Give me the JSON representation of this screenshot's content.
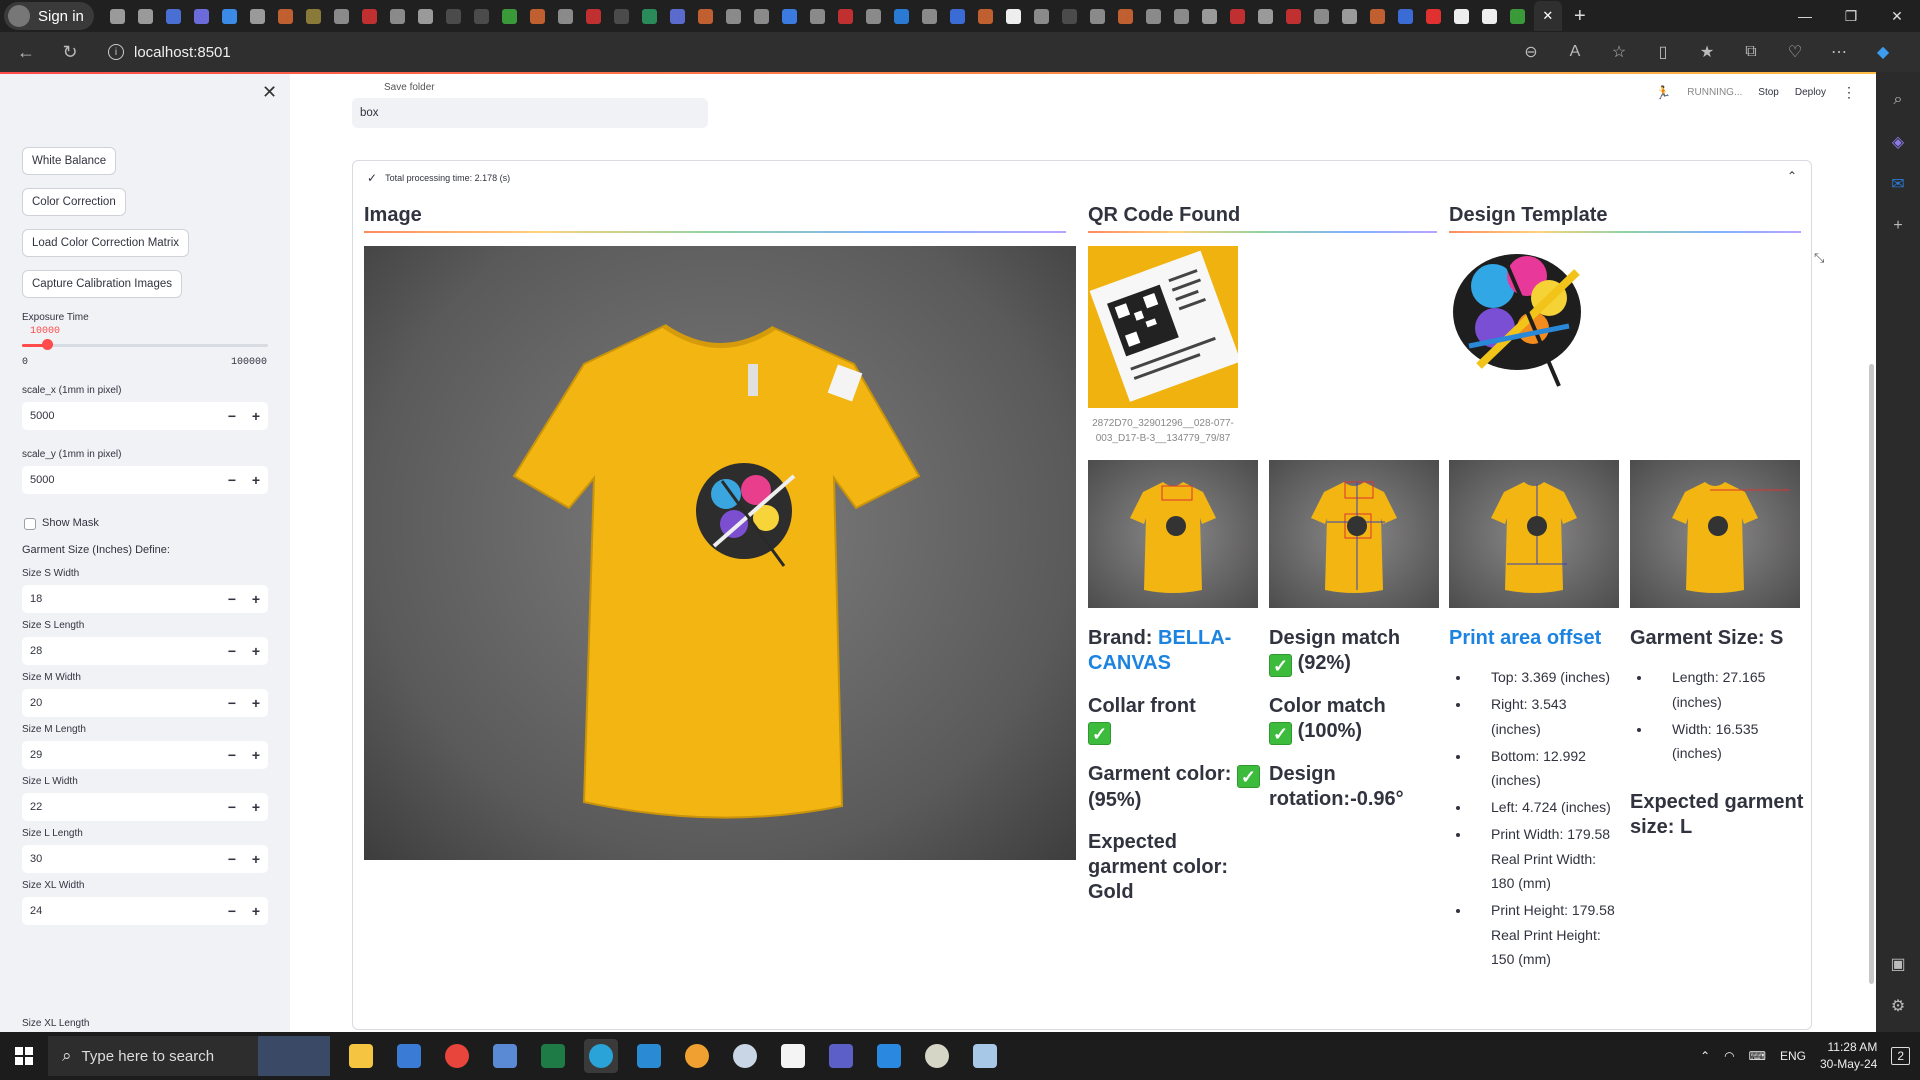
{
  "browser": {
    "signin_label": "Sign in",
    "url": "localhost:8501",
    "tab_icon_colors": [
      "#9a9a9a",
      "#9a9a9a",
      "#4a6fd4",
      "#6b6bd9",
      "#3b8be6",
      "#9a9a9a",
      "#c06030",
      "#8a7a3a",
      "#8a8a8a",
      "#c03030",
      "#8a8a8a",
      "#9a9a9a",
      "#4b4b4b",
      "#4b4b4b",
      "#3a9a3a",
      "#c06030",
      "#8a8a8a",
      "#c03030",
      "#4b4b4b",
      "#2a8a5a",
      "#5a6acd",
      "#c06030",
      "#8a8a8a",
      "#8a8a8a",
      "#3b7be0",
      "#8a8a8a",
      "#c03030",
      "#8a8a8a",
      "#2a7ad4",
      "#8a8a8a",
      "#3b6bd4",
      "#c06030",
      "#eeeeee",
      "#8a8a8a",
      "#4b4b4b",
      "#8a8a8a",
      "#c06030",
      "#8a8a8a",
      "#8a8a8a",
      "#9a9a9a",
      "#c03030",
      "#9a9a9a",
      "#c03030",
      "#8a8a8a",
      "#9a9a9a",
      "#c06030",
      "#3b6bd4",
      "#e03030",
      "#eeeeee",
      "#eeeeee",
      "#3a9a3a"
    ]
  },
  "sidebar": {
    "buttons": {
      "white_balance": "White Balance",
      "color_correction": "Color Correction",
      "load_ccm": "Load Color Correction Matrix",
      "capture_calibration": "Capture Calibration Images"
    },
    "exposure": {
      "label": "Exposure Time",
      "value": "10000",
      "min": "0",
      "max": "100000",
      "fraction": 0.1
    },
    "scale_x": {
      "label": "scale_x (1mm in pixel)",
      "value": "5000"
    },
    "scale_y": {
      "label": "scale_y (1mm in pixel)",
      "value": "5000"
    },
    "show_mask": "Show Mask",
    "garment_size_header": "Garment Size (Inches) Define:",
    "size_fields": [
      {
        "label": "Size S Width",
        "value": "18"
      },
      {
        "label": "Size S Length",
        "value": "28"
      },
      {
        "label": "Size M Width",
        "value": "20"
      },
      {
        "label": "Size M Length",
        "value": "29"
      },
      {
        "label": "Size L Width",
        "value": "22"
      },
      {
        "label": "Size L Length",
        "value": "30"
      },
      {
        "label": "Size XL Width",
        "value": "24"
      }
    ],
    "size_xl_length_label": "Size XL Length"
  },
  "status": {
    "running": "RUNNING...",
    "stop": "Stop",
    "deploy": "Deploy"
  },
  "main": {
    "save_folder_label": "Save folder",
    "save_folder_value": "box",
    "processing_time": "Total processing time: 2.178 (s)",
    "headings": {
      "image": "Image",
      "qr": "QR Code Found",
      "design": "Design Template"
    },
    "qr_caption": "2872D70_32901296__028-077-003_D17-B-3__134779_79/87",
    "brand_label": "Brand:",
    "brand_value": "BELLA-CANVAS",
    "collar_front": "Collar front",
    "garment_color": "Garment color:",
    "garment_color_pct": "(95%)",
    "expected_color": "Expected garment color: Gold",
    "design_match": "Design match",
    "design_match_pct": "(92%)",
    "color_match": "Color match",
    "color_match_pct": "(100%)",
    "design_rotation": "Design rotation:-0.96°",
    "print_offset_title": "Print area offset",
    "print_offset_items": [
      "Top: 3.369 (inches)",
      "Right: 3.543 (inches)",
      "Bottom: 12.992 (inches)",
      "Left: 4.724 (inches)",
      "Print Width: 179.58 Real Print Width: 180 (mm)",
      "Print Height: 179.58 Real Print Height: 150 (mm)"
    ],
    "garment_size_title": "Garment Size: S",
    "garment_size_items": [
      "Length: 27.165 (inches)",
      "Width: 16.535 (inches)"
    ],
    "expected_size": "Expected garment size: L"
  },
  "taskbar": {
    "search_placeholder": "Type here to search",
    "language": "ENG",
    "time": "11:28 AM",
    "date": "30-May-24",
    "notifications": "2"
  }
}
